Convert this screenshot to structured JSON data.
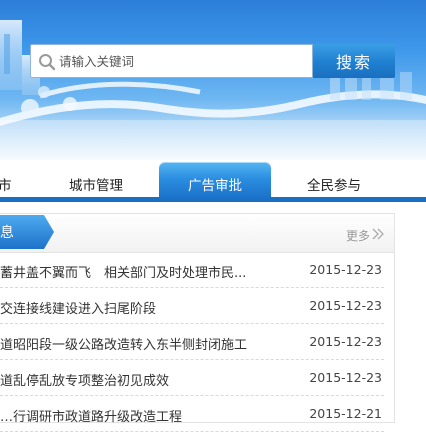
{
  "search": {
    "placeholder": "请输入关键词",
    "button_label": "搜索"
  },
  "nav": {
    "items": [
      {
        "label": "市"
      },
      {
        "label": "城市管理"
      },
      {
        "label": "广告审批",
        "active": true
      },
      {
        "label": "全民参与"
      }
    ]
  },
  "news": {
    "title": "息",
    "more_label": "更多",
    "more_icon": "double-chevron-right-icon",
    "items": [
      {
        "title": "蓄井盖不翼而飞　相关部门及时处理市民...",
        "date": "2015-12-23"
      },
      {
        "title": "交连接线建设进入扫尾阶段",
        "date": "2015-12-23"
      },
      {
        "title": "道昭阳段一级公路改造转入东半侧封闭施工",
        "date": "2015-12-23"
      },
      {
        "title": "道乱停乱放专项整治初见成效",
        "date": "2015-12-23"
      },
      {
        "title": "…行调研市政道路升级改造工程",
        "date": "2015-12-21"
      }
    ]
  },
  "colors": {
    "accent": "#1b6fc0",
    "nav_active": "#2a8de0",
    "search_button": "#1f7fd0"
  }
}
